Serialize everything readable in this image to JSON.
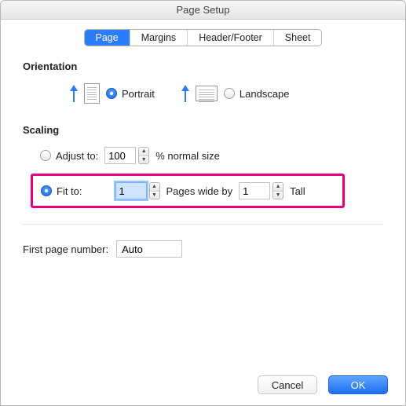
{
  "window": {
    "title": "Page Setup"
  },
  "tabs": {
    "items": [
      {
        "label": "Page"
      },
      {
        "label": "Margins"
      },
      {
        "label": "Header/Footer"
      },
      {
        "label": "Sheet"
      }
    ]
  },
  "orientation": {
    "title": "Orientation",
    "portrait_label": "Portrait",
    "landscape_label": "Landscape"
  },
  "scaling": {
    "title": "Scaling",
    "adjust_label": "Adjust to:",
    "adjust_value": "100",
    "adjust_suffix": "% normal size",
    "fit_label": "Fit to:",
    "fit_wide_value": "1",
    "fit_middle": "Pages wide by",
    "fit_tall_value": "1",
    "fit_tall_suffix": "Tall"
  },
  "first_page": {
    "label": "First page number:",
    "value": "Auto"
  },
  "footer": {
    "cancel": "Cancel",
    "ok": "OK"
  }
}
